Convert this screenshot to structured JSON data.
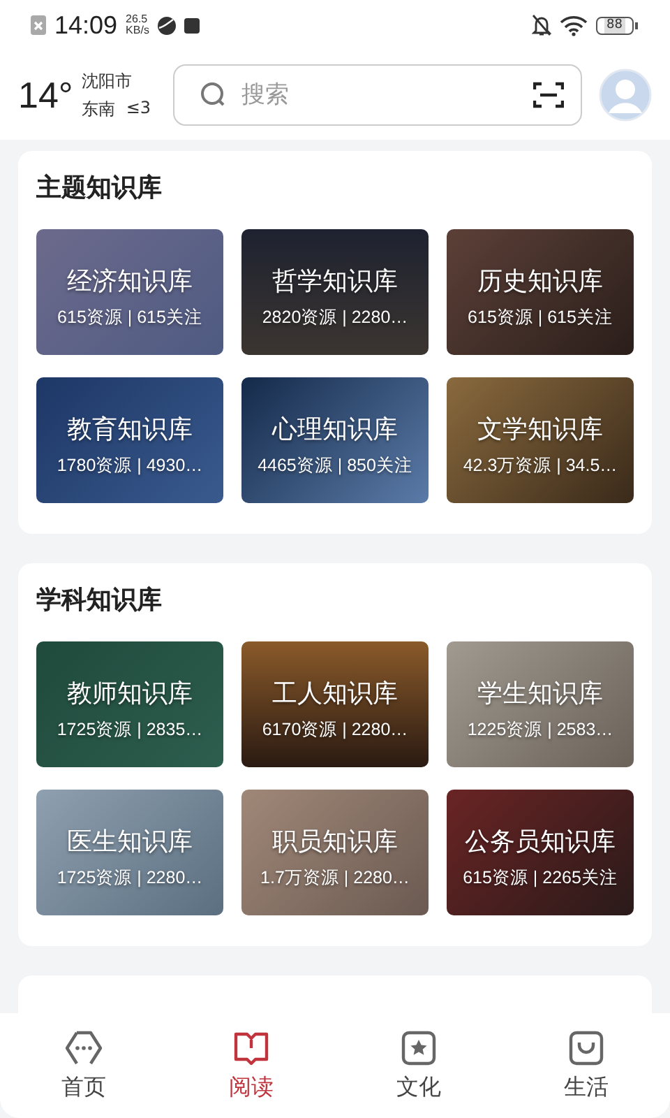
{
  "status_bar": {
    "time": "14:09",
    "speed_value": "26.5",
    "speed_unit": "KB/s",
    "battery": "88"
  },
  "header": {
    "temperature": "14°",
    "city": "沈阳市",
    "wind_direction": "东南",
    "wind_level": "≤3",
    "search": {
      "placeholder": "搜索"
    }
  },
  "sections": [
    {
      "kind": "full",
      "title": "主题知识库",
      "tiles": [
        {
          "title": "经济知识库",
          "stats": "615资源 | 615关注"
        },
        {
          "title": "哲学知识库",
          "stats": "2820资源 | 2280…"
        },
        {
          "title": "历史知识库",
          "stats": "615资源 | 615关注"
        },
        {
          "title": "教育知识库",
          "stats": "1780资源 | 4930…"
        },
        {
          "title": "心理知识库",
          "stats": "4465资源 | 850关注"
        },
        {
          "title": "文学知识库",
          "stats": "42.3万资源 | 34.5…"
        }
      ]
    },
    {
      "kind": "full",
      "title": "学科知识库",
      "tiles": [
        {
          "title": "教师知识库",
          "stats": "1725资源 | 2835…"
        },
        {
          "title": "工人知识库",
          "stats": "6170资源 | 2280…"
        },
        {
          "title": "学生知识库",
          "stats": "1225资源 | 2583…"
        },
        {
          "title": "医生知识库",
          "stats": "1725资源 | 2280…"
        },
        {
          "title": "职员知识库",
          "stats": "1.7万资源 | 2280…"
        },
        {
          "title": "公务员知识库",
          "stats": "615资源 | 2265关注"
        }
      ]
    },
    {
      "kind": "cut_off"
    }
  ],
  "nav": [
    {
      "kind": "home",
      "label": "首页",
      "selected": false
    },
    {
      "kind": "read",
      "label": "阅读",
      "selected": true
    },
    {
      "kind": "culture",
      "label": "文化",
      "selected": false
    },
    {
      "kind": "life",
      "label": "生活",
      "selected": false
    }
  ]
}
